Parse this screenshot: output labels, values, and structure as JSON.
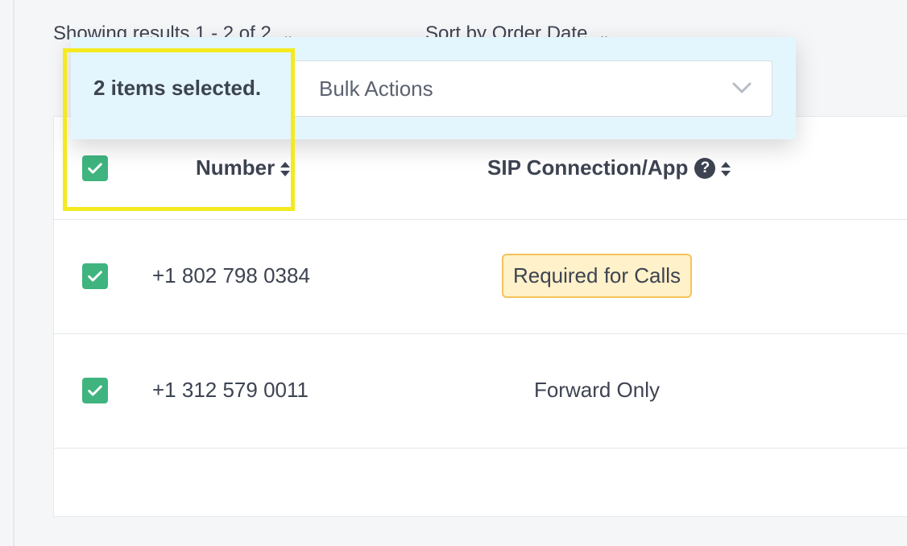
{
  "toolbar": {
    "showing_label": "Showing results 1 - 2 of 2",
    "sort_label": "Sort by Order Date"
  },
  "bulk_bar": {
    "selected_label": "2 items selected.",
    "select_placeholder": "Bulk Actions"
  },
  "table": {
    "columns": [
      {
        "label": "Number",
        "sortable": true
      },
      {
        "label": "SIP Connection/App",
        "sortable": true,
        "help_icon": "question-circle-icon"
      }
    ],
    "rows": [
      {
        "number": "+1 802 798 0384",
        "sip": "Required for Calls",
        "sip_style": "warning-badge",
        "checked": true
      },
      {
        "number": "+1 312 579 0011",
        "sip": "Forward Only",
        "sip_style": "plain",
        "checked": true
      }
    ]
  },
  "colors": {
    "checkbox_green": "#3fb47f",
    "bulk_bar_bg": "#e3f6fd",
    "badge_bg": "#fff1c9",
    "badge_border": "#f4c35a",
    "highlight": "#f4ea1e"
  }
}
